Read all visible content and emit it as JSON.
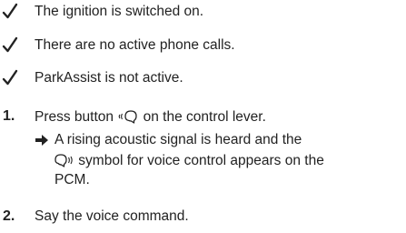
{
  "requirements": [
    {
      "icon": "checkmark-icon",
      "text": "The ignition is switched on."
    },
    {
      "icon": "checkmark-icon",
      "text": "There are no active phone calls."
    },
    {
      "icon": "checkmark-icon",
      "text": "ParkAssist is not active."
    }
  ],
  "steps": [
    {
      "number": "1.",
      "text_before": "Press button ",
      "icon": "voice-button-icon",
      "text_after": " on the control lever.",
      "result": {
        "icon": "result-arrow-icon",
        "line1": "A rising acoustic signal is heard and the",
        "line2_icon": "voice-control-symbol-icon",
        "line2_text": " symbol for voice control appears on the",
        "line3": "PCM."
      }
    },
    {
      "number": "2.",
      "text": "Say the voice command."
    }
  ],
  "colors": {
    "text": "#222222",
    "background": "#ffffff"
  }
}
